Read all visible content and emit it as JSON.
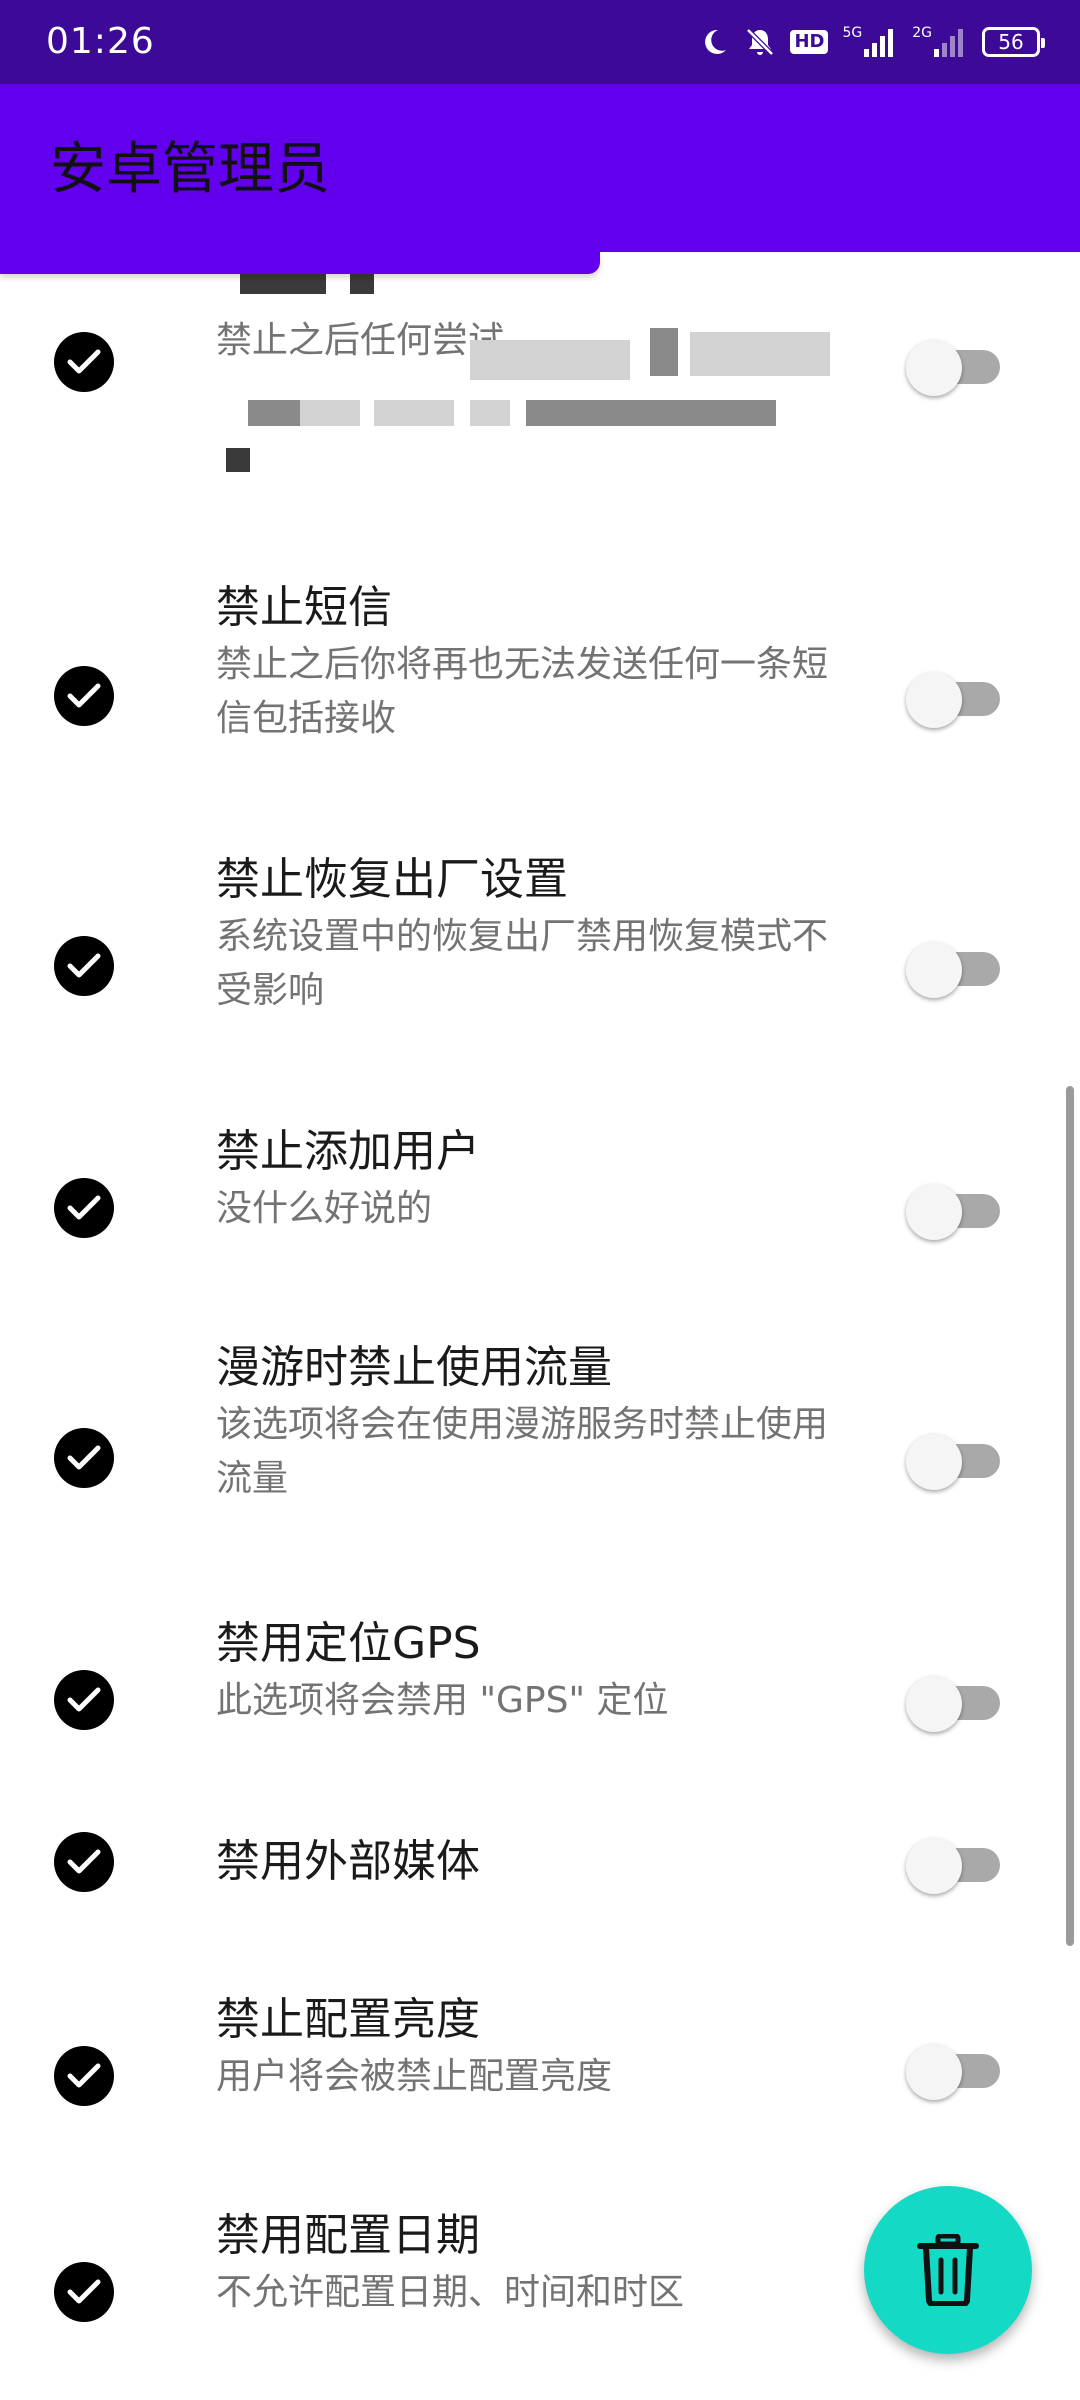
{
  "status_bar": {
    "time": "01:26",
    "hd_label": "HD",
    "net1_label": "5G",
    "net2_label": "2G",
    "battery": "56",
    "icons": [
      "moon-icon",
      "bell-off-icon",
      "hd-icon",
      "signal-icon",
      "signal-icon",
      "battery-icon"
    ]
  },
  "app_bar": {
    "title": "安卓管理员",
    "color": "#6200ee"
  },
  "items": [
    {
      "title": "禁止短信",
      "desc": "禁止之后你将再也无法发送任何一条短信包括接收",
      "enabled": false
    },
    {
      "title": "禁止恢复出厂设置",
      "desc": "系统设置中的恢复出厂禁用恢复模式不受影响",
      "enabled": false
    },
    {
      "title": "禁止添加用户",
      "desc": "没什么好说的",
      "enabled": false
    },
    {
      "title": "漫游时禁止使用流量",
      "desc": "该选项将会在使用漫游服务时禁止使用流量",
      "enabled": false
    },
    {
      "title": "禁用定位GPS",
      "desc": "此选项将会禁用 \"GPS\" 定位",
      "enabled": false
    },
    {
      "title": "禁用外部媒体",
      "desc": "",
      "enabled": false
    },
    {
      "title": "禁止配置亮度",
      "desc": "用户将会被禁止配置亮度",
      "enabled": false
    },
    {
      "title": "禁用配置日期",
      "desc": "不允许配置日期、时间和时区",
      "enabled": false
    }
  ],
  "partial_item": {
    "desc_visible": "禁止之后任何尝试"
  },
  "fab": {
    "icon": "trash-icon",
    "color": "#14d9c5"
  }
}
